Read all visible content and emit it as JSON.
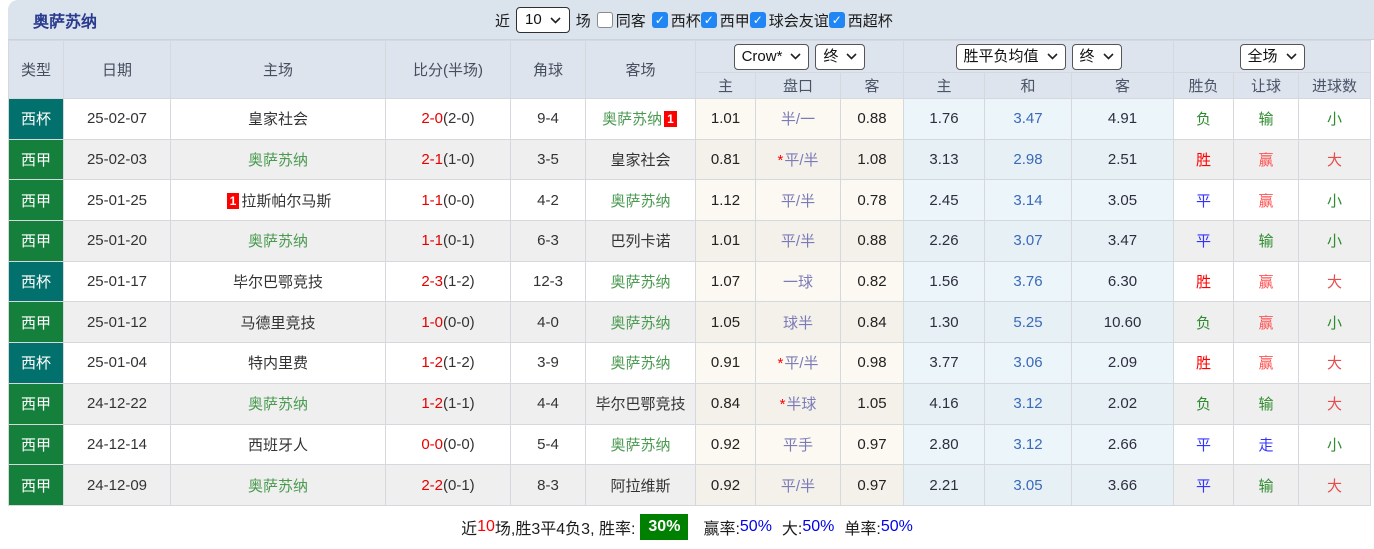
{
  "header": {
    "title": "奥萨苏纳",
    "recent_label": "近",
    "recent_select": "10",
    "matches_label": "场",
    "same_opponent_label": "同客",
    "filters": [
      {
        "label": "西杯",
        "checked": true
      },
      {
        "label": "西甲",
        "checked": true
      },
      {
        "label": "球会友谊",
        "checked": true
      },
      {
        "label": "西超杯",
        "checked": true
      }
    ]
  },
  "table": {
    "columns": [
      "类型",
      "日期",
      "主场",
      "比分(半场)",
      "角球",
      "客场"
    ],
    "odds_group": {
      "bookmaker": "Crow*",
      "period": "终"
    },
    "avg_group": {
      "label": "胜平负均值",
      "period": "终"
    },
    "result_group": {
      "label": "全场"
    },
    "sub_headers": [
      "主",
      "盘口",
      "客",
      "主",
      "和",
      "客",
      "胜负",
      "让球",
      "进球数"
    ],
    "league_colors": {
      "西杯": "#02706c",
      "西甲": "#15803c"
    },
    "focus_team_color": "#4a9a50",
    "rows": [
      {
        "league": "西杯",
        "league_color": "#02706c",
        "date": "25-02-07",
        "home": {
          "name": "皇家社会",
          "focus": false
        },
        "score": {
          "full": "2-0",
          "half": "(2-0)"
        },
        "corners": "9-4",
        "away": {
          "name": "奥萨苏纳",
          "focus": true,
          "badge_after": "1"
        },
        "crow": {
          "home": "1.01",
          "star": false,
          "handicap": "半/一",
          "away": "0.88"
        },
        "avg": {
          "home": "1.76",
          "draw": "3.47",
          "away": "4.91"
        },
        "result": [
          {
            "t": "负",
            "c": "#2e8b2e"
          },
          {
            "t": "输",
            "c": "#2e8b2e"
          },
          {
            "t": "小",
            "c": "#2e8b2e"
          }
        ]
      },
      {
        "league": "西甲",
        "league_color": "#15803c",
        "date": "25-02-03",
        "home": {
          "name": "奥萨苏纳",
          "focus": true
        },
        "score": {
          "full": "2-1",
          "half": "(1-0)"
        },
        "corners": "3-5",
        "away": {
          "name": "皇家社会",
          "focus": false
        },
        "crow": {
          "home": "0.81",
          "star": true,
          "handicap": "平/半",
          "away": "1.08"
        },
        "avg": {
          "home": "3.13",
          "draw": "2.98",
          "away": "2.51"
        },
        "result": [
          {
            "t": "胜",
            "c": "#ff0000"
          },
          {
            "t": "赢",
            "c": "#ff5252"
          },
          {
            "t": "大",
            "c": "#e64c4c"
          }
        ]
      },
      {
        "league": "西甲",
        "league_color": "#15803c",
        "date": "25-01-25",
        "home": {
          "name": "拉斯帕尔马斯",
          "focus": false,
          "badge_before": "1"
        },
        "score": {
          "full": "1-1",
          "half": "(0-0)"
        },
        "corners": "4-2",
        "away": {
          "name": "奥萨苏纳",
          "focus": true
        },
        "crow": {
          "home": "1.12",
          "star": false,
          "handicap": "平/半",
          "away": "0.78"
        },
        "avg": {
          "home": "2.45",
          "draw": "3.14",
          "away": "3.05"
        },
        "result": [
          {
            "t": "平",
            "c": "#3333ff"
          },
          {
            "t": "赢",
            "c": "#ff5252"
          },
          {
            "t": "小",
            "c": "#2e8b2e"
          }
        ]
      },
      {
        "league": "西甲",
        "league_color": "#15803c",
        "date": "25-01-20",
        "home": {
          "name": "奥萨苏纳",
          "focus": true
        },
        "score": {
          "full": "1-1",
          "half": "(0-1)"
        },
        "corners": "6-3",
        "away": {
          "name": "巴列卡诺",
          "focus": false
        },
        "crow": {
          "home": "1.01",
          "star": false,
          "handicap": "平/半",
          "away": "0.88"
        },
        "avg": {
          "home": "2.26",
          "draw": "3.07",
          "away": "3.47"
        },
        "result": [
          {
            "t": "平",
            "c": "#3333ff"
          },
          {
            "t": "输",
            "c": "#2e8b2e"
          },
          {
            "t": "小",
            "c": "#2e8b2e"
          }
        ]
      },
      {
        "league": "西杯",
        "league_color": "#02706c",
        "date": "25-01-17",
        "home": {
          "name": "毕尔巴鄂竞技",
          "focus": false
        },
        "score": {
          "full": "2-3",
          "half": "(1-2)"
        },
        "corners": "12-3",
        "away": {
          "name": "奥萨苏纳",
          "focus": true
        },
        "crow": {
          "home": "1.07",
          "star": false,
          "handicap": "一球",
          "away": "0.82"
        },
        "avg": {
          "home": "1.56",
          "draw": "3.76",
          "away": "6.30"
        },
        "result": [
          {
            "t": "胜",
            "c": "#ff0000"
          },
          {
            "t": "赢",
            "c": "#ff5252"
          },
          {
            "t": "大",
            "c": "#e64c4c"
          }
        ]
      },
      {
        "league": "西甲",
        "league_color": "#15803c",
        "date": "25-01-12",
        "home": {
          "name": "马德里竞技",
          "focus": false
        },
        "score": {
          "full": "1-0",
          "half": "(0-0)"
        },
        "corners": "4-0",
        "away": {
          "name": "奥萨苏纳",
          "focus": true
        },
        "crow": {
          "home": "1.05",
          "star": false,
          "handicap": "球半",
          "away": "0.84"
        },
        "avg": {
          "home": "1.30",
          "draw": "5.25",
          "away": "10.60"
        },
        "result": [
          {
            "t": "负",
            "c": "#2e8b2e"
          },
          {
            "t": "赢",
            "c": "#ff5252"
          },
          {
            "t": "小",
            "c": "#2e8b2e"
          }
        ]
      },
      {
        "league": "西杯",
        "league_color": "#02706c",
        "date": "25-01-04",
        "home": {
          "name": "特内里费",
          "focus": false
        },
        "score": {
          "full": "1-2",
          "half": "(1-2)"
        },
        "corners": "3-9",
        "away": {
          "name": "奥萨苏纳",
          "focus": true
        },
        "crow": {
          "home": "0.91",
          "star": true,
          "handicap": "平/半",
          "away": "0.98"
        },
        "avg": {
          "home": "3.77",
          "draw": "3.06",
          "away": "2.09"
        },
        "result": [
          {
            "t": "胜",
            "c": "#ff0000"
          },
          {
            "t": "赢",
            "c": "#ff5252"
          },
          {
            "t": "大",
            "c": "#e64c4c"
          }
        ]
      },
      {
        "league": "西甲",
        "league_color": "#15803c",
        "date": "24-12-22",
        "home": {
          "name": "奥萨苏纳",
          "focus": true
        },
        "score": {
          "full": "1-2",
          "half": "(1-1)"
        },
        "corners": "4-4",
        "away": {
          "name": "毕尔巴鄂竞技",
          "focus": false
        },
        "crow": {
          "home": "0.84",
          "star": true,
          "handicap": "半球",
          "away": "1.05"
        },
        "avg": {
          "home": "4.16",
          "draw": "3.12",
          "away": "2.02"
        },
        "result": [
          {
            "t": "负",
            "c": "#2e8b2e"
          },
          {
            "t": "输",
            "c": "#2e8b2e"
          },
          {
            "t": "大",
            "c": "#e64c4c"
          }
        ]
      },
      {
        "league": "西甲",
        "league_color": "#15803c",
        "date": "24-12-14",
        "home": {
          "name": "西班牙人",
          "focus": false
        },
        "score": {
          "full": "0-0",
          "half": "(0-0)"
        },
        "corners": "5-4",
        "away": {
          "name": "奥萨苏纳",
          "focus": true
        },
        "crow": {
          "home": "0.92",
          "star": false,
          "handicap": "平手",
          "away": "0.97"
        },
        "avg": {
          "home": "2.80",
          "draw": "3.12",
          "away": "2.66"
        },
        "result": [
          {
            "t": "平",
            "c": "#3333ff"
          },
          {
            "t": "走",
            "c": "#3333ff"
          },
          {
            "t": "小",
            "c": "#2e8b2e"
          }
        ]
      },
      {
        "league": "西甲",
        "league_color": "#15803c",
        "date": "24-12-09",
        "home": {
          "name": "奥萨苏纳",
          "focus": true
        },
        "score": {
          "full": "2-2",
          "half": "(0-1)"
        },
        "corners": "8-3",
        "away": {
          "name": "阿拉维斯",
          "focus": false
        },
        "crow": {
          "home": "0.92",
          "star": false,
          "handicap": "平/半",
          "away": "0.97"
        },
        "avg": {
          "home": "2.21",
          "draw": "3.05",
          "away": "3.66"
        },
        "result": [
          {
            "t": "平",
            "c": "#3333ff"
          },
          {
            "t": "输",
            "c": "#2e8b2e"
          },
          {
            "t": "大",
            "c": "#e64c4c"
          }
        ]
      }
    ]
  },
  "footer": {
    "near_label": "近",
    "count": "10",
    "summary": "场,胜3平4负3, 胜率:",
    "win_rate": "30%",
    "win_rate_bg": "#008000",
    "rate1_label": "赢率:",
    "rate1_value": "50%",
    "rate2_label": "大:",
    "rate2_value": "50%",
    "rate3_label": "单率:",
    "rate3_value": "50%"
  },
  "colors": {
    "topbar_bg": "#dbe3ed",
    "header_bg": "#dee4ed",
    "title_text": "#2a3b8f",
    "score_red": "#e60000",
    "handicap_text": "#7b7bb8",
    "draw_odds_blue": "#3a6ab8",
    "checkbox_blue": "#2086f3"
  }
}
